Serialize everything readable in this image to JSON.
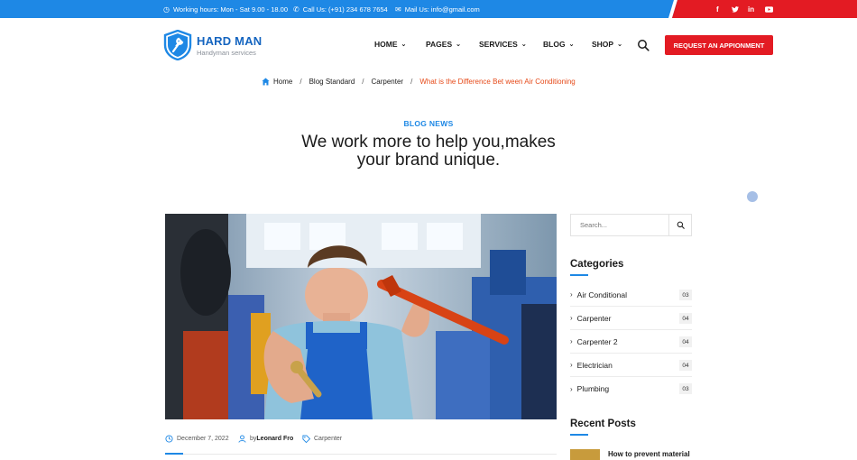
{
  "topbar": {
    "hours": "Working hours: Mon - Sat 9.00 - 18.00",
    "phone": "Call Us: (+91) 234 678 7654",
    "mail": "Mail Us: info@gmail.com",
    "social": [
      "f",
      "t",
      "in",
      "yt"
    ]
  },
  "brand": {
    "name": "HARD MAN",
    "tagline": "Handyman services"
  },
  "nav": [
    {
      "label": "HOME"
    },
    {
      "label": "PAGES"
    },
    {
      "label": "SERVICES"
    },
    {
      "label": "BLOG"
    },
    {
      "label": "SHOP"
    }
  ],
  "cta": "REQUEST AN APPIONMENT",
  "breadcrumb": {
    "home": "Home",
    "items": [
      "Blog Standard",
      "Carpenter"
    ],
    "current": "What is the Difference Bet ween Air Conditioning"
  },
  "hero": {
    "kicker": "BLOG NEWS",
    "title_line1": "We work more to help you,makes",
    "title_line2": "your brand unique."
  },
  "post_meta": {
    "date": "December 7, 2022",
    "by": "by",
    "author": "Leonard Fro",
    "category": "Carpenter"
  },
  "sidebar": {
    "search_placeholder": "Search...",
    "categories_title": "Categories",
    "categories": [
      {
        "name": "Air Conditional",
        "count": "03"
      },
      {
        "name": "Carpenter",
        "count": "04"
      },
      {
        "name": "Carpenter 2",
        "count": "04"
      },
      {
        "name": "Electrician",
        "count": "04"
      },
      {
        "name": "Plumbing",
        "count": "03"
      }
    ],
    "recent_title": "Recent Posts",
    "recent_first": "How to prevent material"
  },
  "colors": {
    "blue": "#1e88e5",
    "red": "#e31b23",
    "accent_orange": "#e64a19"
  }
}
